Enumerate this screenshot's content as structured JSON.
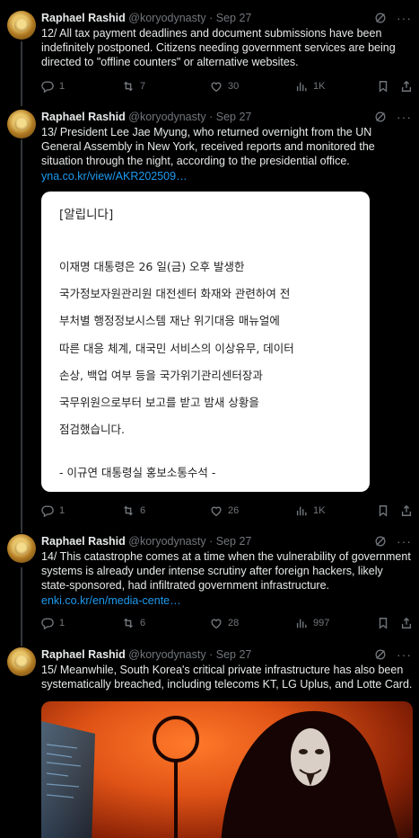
{
  "author": {
    "name": "Raphael Rashid",
    "handle": "@koryodynasty",
    "separator": "·"
  },
  "tweets": [
    {
      "date": "Sep 27",
      "text": "12/ All tax payment deadlines and document submissions have been indefinitely postponed. Citizens needing government services are being directed to \"offline counters\" or alternative websites.",
      "replies": "1",
      "reposts": "7",
      "likes": "30",
      "views": "1K"
    },
    {
      "date": "Sep 27",
      "text": "13/ President Lee Jae Myung, who returned overnight from the UN General Assembly in New York, received reports and monitored the situation through the night, according to the presidential office.",
      "link": "yna.co.kr/view/AKR202509…",
      "replies": "1",
      "reposts": "6",
      "likes": "26",
      "views": "1K"
    },
    {
      "date": "Sep 27",
      "text": "14/ This catastrophe comes at a time when the vulnerability of government systems is already under intense scrutiny after foreign hackers, likely state-sponsored, had infiltrated government infrastructure.",
      "link": "enki.co.kr/en/media-cente…",
      "replies": "1",
      "reposts": "6",
      "likes": "28",
      "views": "997"
    },
    {
      "date": "Sep 27",
      "text": "15/ Meanwhile, South Korea's critical private infrastructure has also been systematically breached, including telecoms KT, LG Uplus, and Lotte Card."
    }
  ],
  "statement_card": {
    "lines": [
      "[알립니다]",
      "이재명 대통령은 26 일(금) 오후 발생한",
      "국가정보자원관리원 대전센터 화재와 관련하여 전",
      "부처별 행정정보시스템 재난 위기대응 매뉴얼에",
      "따른 대응 체계, 대국민 서비스의 이상유무, 데이터",
      "손상, 백업 여부 등을 국가위기관리센터장과",
      "국무위원으로부터 보고를 받고 밤새 상황을",
      "점검했습니다.",
      "- 이규연 대통령실 홍보소통수석 -"
    ]
  },
  "icons": {
    "reply": "reply-icon",
    "repost": "repost-icon",
    "like": "heart-icon",
    "views": "views-icon",
    "bookmark": "bookmark-icon",
    "share": "share-icon",
    "grok": "grok-icon",
    "more": "more-icon"
  },
  "colors": {
    "background": "#000000",
    "text": "#e7e9ea",
    "muted": "#71767b",
    "link": "#1d9bf0"
  }
}
